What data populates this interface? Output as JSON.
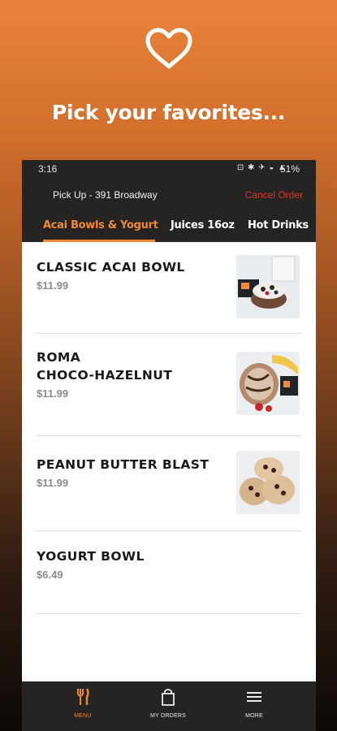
{
  "hero": {
    "title": "Pick your favorites..."
  },
  "status": {
    "time": "3:16",
    "battery": "51%"
  },
  "order": {
    "pickup_label": "Pick Up - 391 Broadway",
    "cancel_label": "Cancel Order"
  },
  "tabs": [
    "Acai Bowls & Yogurt",
    "Juices 16oz",
    "Hot Drinks"
  ],
  "items": [
    {
      "name_lines": [
        "CLASSIC ACAI BOWL"
      ],
      "price": "$11.99"
    },
    {
      "name_lines": [
        "ROMA",
        "CHOCO-HAZELNUT"
      ],
      "price": "$11.99"
    },
    {
      "name_lines": [
        "PEANUT BUTTER BLAST"
      ],
      "price": "$11.99"
    },
    {
      "name_lines": [
        "YOGURT BOWL"
      ],
      "price": "$6.49"
    }
  ],
  "nav": [
    "MENU",
    "MY ORDERS",
    "MORE"
  ],
  "colors": {
    "accent": "#f08a34",
    "cancel": "#e0332b",
    "bar": "#262323"
  }
}
